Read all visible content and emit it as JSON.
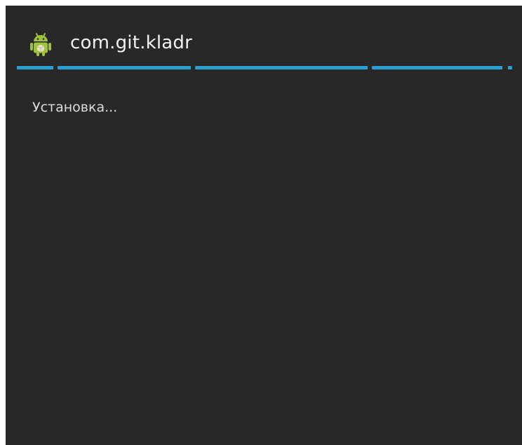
{
  "dialog": {
    "title": "com.git.kladr",
    "icon": "android-icon",
    "status_text": "Установка...",
    "progress_indeterminate": true,
    "accent_color": "#2a9fd0",
    "background_color": "#282828"
  }
}
